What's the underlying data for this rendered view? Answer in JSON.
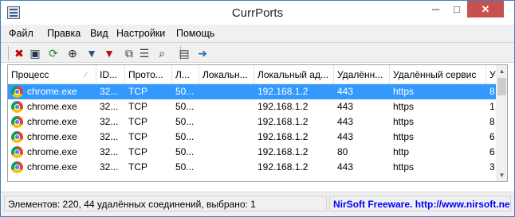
{
  "window": {
    "title": "CurrPorts",
    "minimize": "─",
    "maximize": "□",
    "close": "✕"
  },
  "menu": [
    "Файл",
    "Правка",
    "Вид",
    "Настройки",
    "Помощь"
  ],
  "toolbar": [
    {
      "icon": "close-connections-icon",
      "glyph": "✖",
      "color": "#c00000"
    },
    {
      "icon": "save-icon",
      "glyph": "▣",
      "color": "#20364f"
    },
    {
      "icon": "refresh-icon",
      "glyph": "⟳",
      "color": "#1e8a2e"
    },
    {
      "icon": "target-icon",
      "glyph": "⊕",
      "color": "#222222"
    },
    {
      "icon": "filter-icon",
      "glyph": "▼",
      "color": "#2a4f8f"
    },
    {
      "icon": "filter-red-icon",
      "glyph": "▼",
      "color": "#b01010"
    },
    {
      "icon": "copy-icon",
      "glyph": "⧉",
      "color": "#333333"
    },
    {
      "icon": "properties-icon",
      "glyph": "☰",
      "color": "#444444"
    },
    {
      "icon": "find-icon",
      "glyph": "⌕",
      "color": "#222222"
    },
    {
      "icon": "report-icon",
      "glyph": "▤",
      "color": "#444444"
    },
    {
      "icon": "exit-icon",
      "glyph": "➜",
      "color": "#1f6fb0"
    }
  ],
  "columns": [
    "Процесс",
    "ID...",
    "Прото...",
    "Л...",
    "Локальн...",
    "Локальный ад...",
    "Удалённ...",
    "Удалённый сервис",
    "У"
  ],
  "rows": [
    {
      "process": "chrome.exe",
      "pid": "32...",
      "proto": "TCP",
      "lport": "50...",
      "lname": "",
      "laddr": "192.168.1.2",
      "rport": "443",
      "rservice": "https",
      "extra": "8"
    },
    {
      "process": "chrome.exe",
      "pid": "32...",
      "proto": "TCP",
      "lport": "50...",
      "lname": "",
      "laddr": "192.168.1.2",
      "rport": "443",
      "rservice": "https",
      "extra": "1"
    },
    {
      "process": "chrome.exe",
      "pid": "32...",
      "proto": "TCP",
      "lport": "50...",
      "lname": "",
      "laddr": "192.168.1.2",
      "rport": "443",
      "rservice": "https",
      "extra": "8"
    },
    {
      "process": "chrome.exe",
      "pid": "32...",
      "proto": "TCP",
      "lport": "50...",
      "lname": "",
      "laddr": "192.168.1.2",
      "rport": "443",
      "rservice": "https",
      "extra": "6"
    },
    {
      "process": "chrome.exe",
      "pid": "32...",
      "proto": "TCP",
      "lport": "50...",
      "lname": "",
      "laddr": "192.168.1.2",
      "rport": "80",
      "rservice": "http",
      "extra": "6"
    },
    {
      "process": "chrome.exe",
      "pid": "32...",
      "proto": "TCP",
      "lport": "50...",
      "lname": "",
      "laddr": "192.168.1.2",
      "rport": "443",
      "rservice": "https",
      "extra": "3"
    }
  ],
  "selected_row": 0,
  "status": {
    "summary": "Элементов: 220, 44 удалённых соединений, выбрано: 1",
    "credit": "NirSoft Freeware.  http://www.nirsoft.net"
  },
  "colors": {
    "selection": "#3399ff",
    "link": "#0000ff",
    "close_button": "#c75050"
  }
}
